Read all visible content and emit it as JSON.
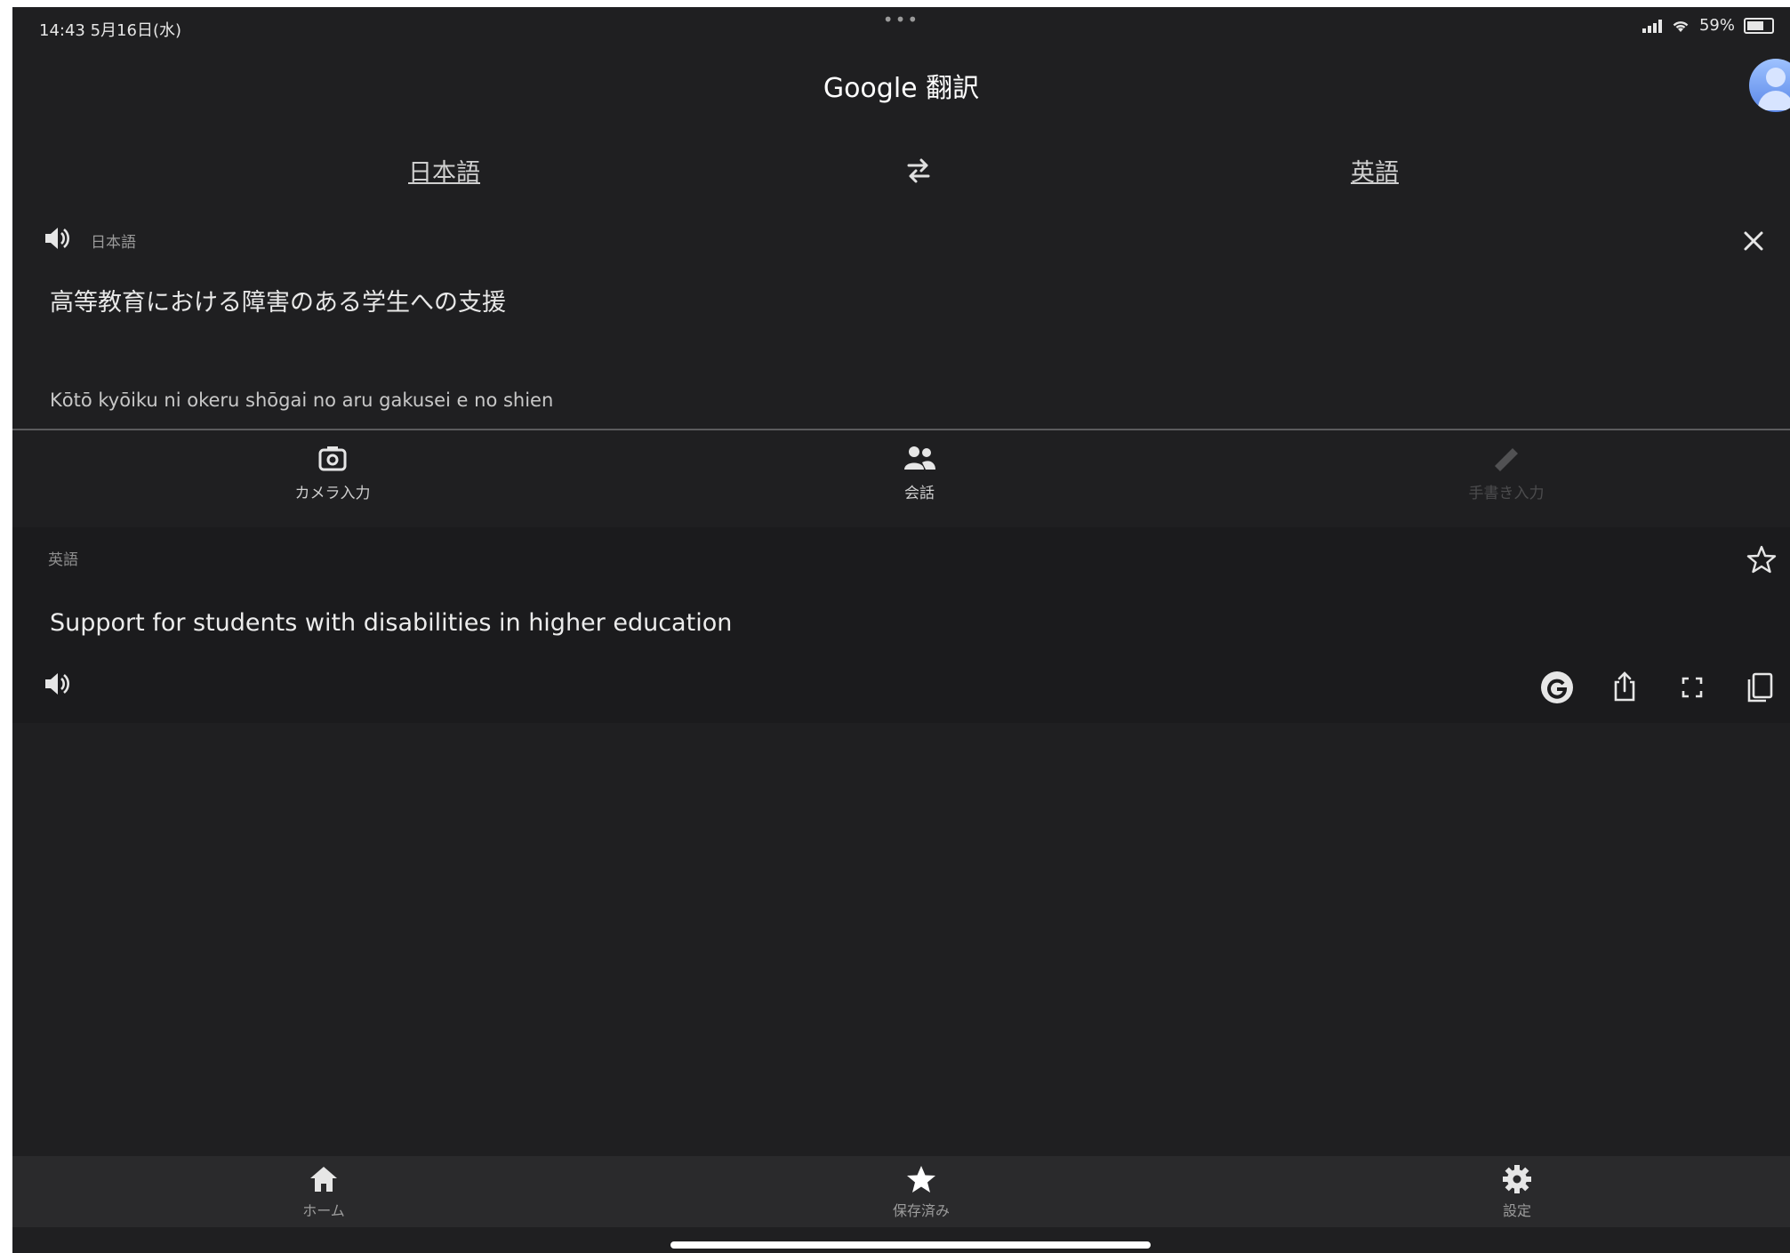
{
  "status_bar": {
    "time_date": "14:43  5月16日(水)",
    "dots": "•••",
    "battery_text": "59%"
  },
  "header": {
    "title": "Google 翻訳"
  },
  "language_bar": {
    "source_language": "日本語",
    "target_language": "英語"
  },
  "source": {
    "language_label": "日本語",
    "text": "高等教育における障害のある学生への支援",
    "romanization": "Kōtō kyōiku ni okeru shōgai no aru gakusei e no shien"
  },
  "input_modes": {
    "camera_label": "カメラ入力",
    "conversation_label": "会話",
    "handwriting_label": "手書き入力"
  },
  "result": {
    "language_label": "英語",
    "text": "Support for students with disabilities in higher education"
  },
  "bottom_nav": {
    "home_label": "ホーム",
    "saved_label": "保存済み",
    "settings_label": "設定"
  },
  "colors": {
    "background": "#1f1f21",
    "result_card": "#1b1b1d",
    "text_primary": "#ececec",
    "accent_avatar": "#5a87e8"
  },
  "icons": {
    "swap": "swap-horiz-icon",
    "speaker": "volume-icon",
    "close": "close-icon",
    "camera": "camera-icon",
    "conversation": "people-icon",
    "star": "star-outline-icon",
    "google": "google-g-icon",
    "share": "share-icon",
    "fullscreen": "fullscreen-icon",
    "copy": "copy-icon",
    "home": "home-icon",
    "saved": "star-filled-icon",
    "settings": "gear-icon"
  }
}
